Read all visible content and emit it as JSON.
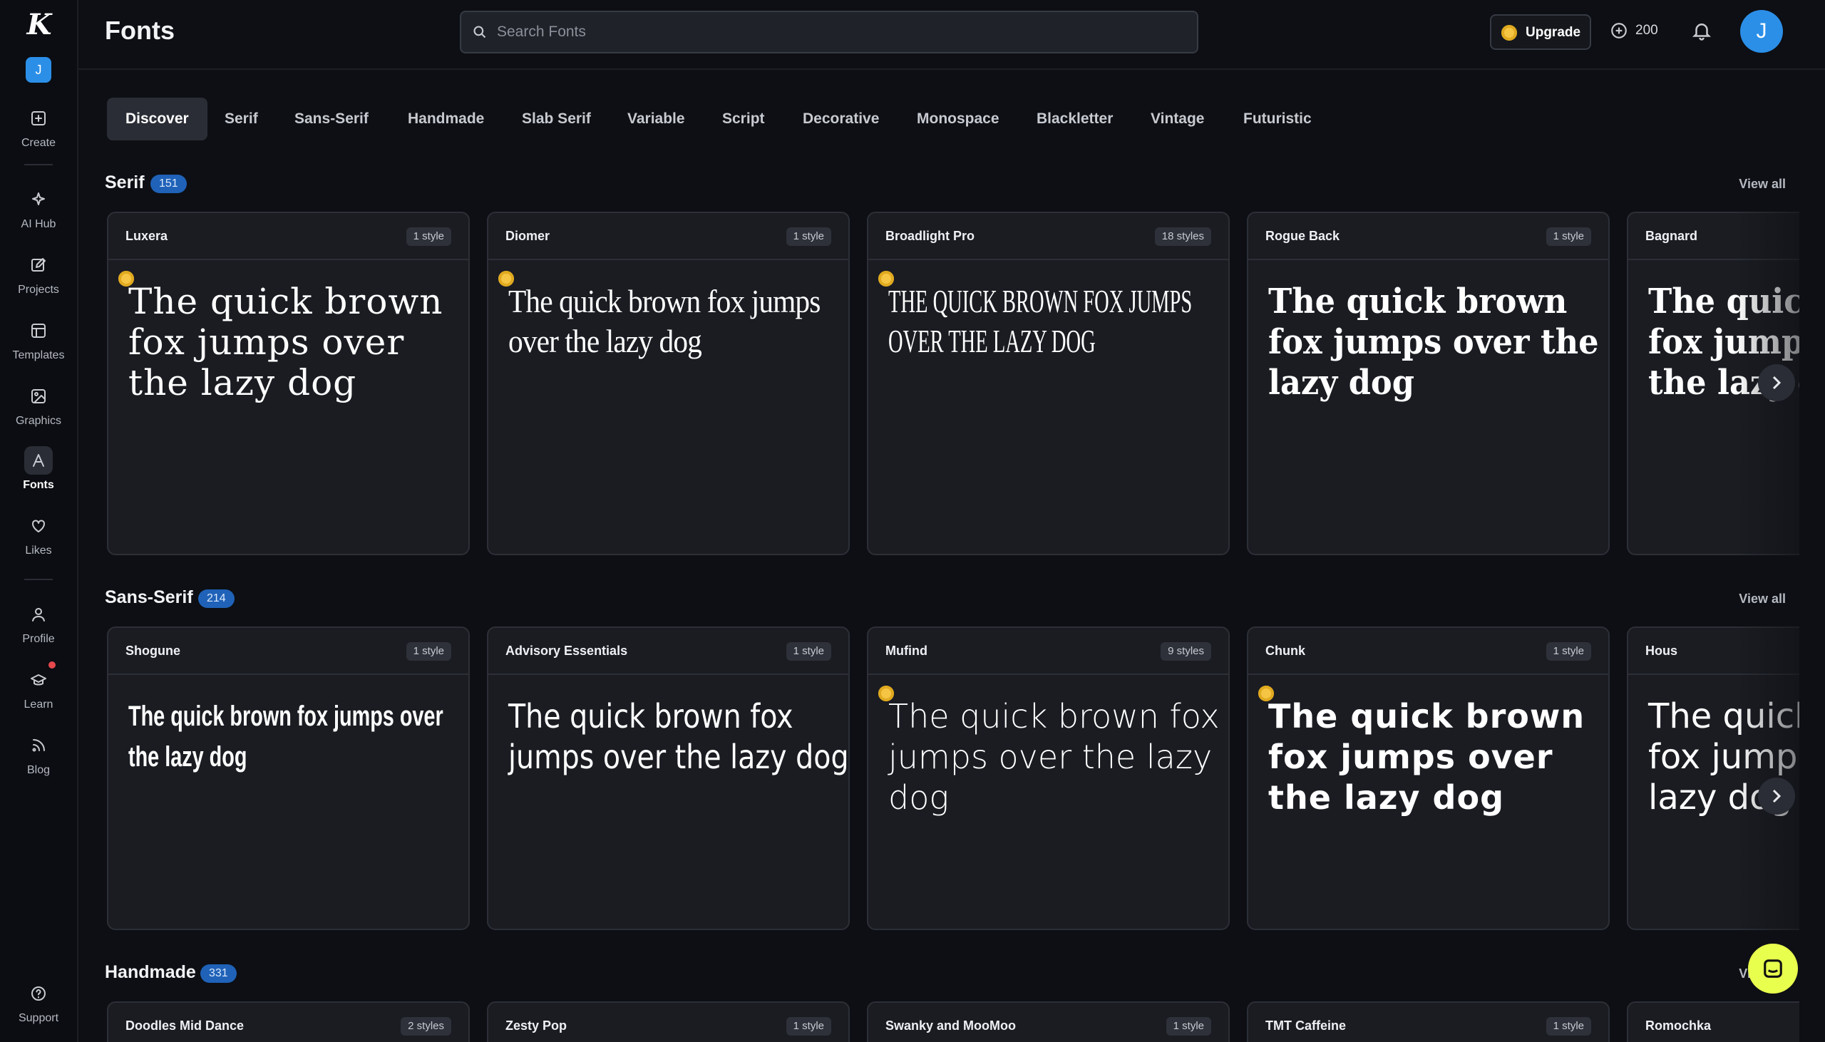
{
  "app": {
    "logo": "K",
    "workspace_initial": "J"
  },
  "sidebar": {
    "items": [
      {
        "label": "Create",
        "icon": "plus-square-icon"
      },
      {
        "label": "AI Hub",
        "icon": "sparkle-icon"
      },
      {
        "label": "Projects",
        "icon": "edit-icon"
      },
      {
        "label": "Templates",
        "icon": "template-icon"
      },
      {
        "label": "Graphics",
        "icon": "image-icon"
      },
      {
        "label": "Fonts",
        "icon": "font-icon",
        "active": true
      },
      {
        "label": "Likes",
        "icon": "heart-icon"
      },
      {
        "label": "Profile",
        "icon": "user-icon"
      },
      {
        "label": "Learn",
        "icon": "graduation-cap-icon"
      },
      {
        "label": "Blog",
        "icon": "rss-icon"
      }
    ],
    "support": "Support"
  },
  "header": {
    "title": "Fonts",
    "search_placeholder": "Search Fonts",
    "upgrade_label": "Upgrade",
    "credits": "200",
    "user_initial": "J"
  },
  "tabs": [
    "Discover",
    "Serif",
    "Sans-Serif",
    "Handmade",
    "Slab Serif",
    "Variable",
    "Script",
    "Decorative",
    "Monospace",
    "Blackletter",
    "Vintage",
    "Futuristic"
  ],
  "view_all_label": "View all",
  "sample_text": "The quick brown fox jumps over the lazy dog",
  "sections": [
    {
      "title": "Serif",
      "count": "151",
      "fonts": [
        {
          "name": "Luxera",
          "styles": "1 style",
          "premium": true
        },
        {
          "name": "Diomer",
          "styles": "1 style",
          "premium": true
        },
        {
          "name": "Broadlight Pro",
          "styles": "18 styles",
          "premium": true
        },
        {
          "name": "Rogue Back",
          "styles": "1 style",
          "premium": false
        },
        {
          "name": "Bagnard",
          "styles": "",
          "premium": false
        }
      ]
    },
    {
      "title": "Sans-Serif",
      "count": "214",
      "fonts": [
        {
          "name": "Shogune",
          "styles": "1 style",
          "premium": false
        },
        {
          "name": "Advisory Essentials",
          "styles": "1 style",
          "premium": false
        },
        {
          "name": "Mufind",
          "styles": "9 styles",
          "premium": true
        },
        {
          "name": "Chunk",
          "styles": "1 style",
          "premium": true
        },
        {
          "name": "Hous",
          "styles": "",
          "premium": false
        }
      ]
    },
    {
      "title": "Handmade",
      "count": "331",
      "fonts": [
        {
          "name": "Doodles Mid Dance",
          "styles": "2 styles"
        },
        {
          "name": "Zesty Pop",
          "styles": "1 style"
        },
        {
          "name": "Swanky and MooMoo",
          "styles": "1 style"
        },
        {
          "name": "TMT Caffeine",
          "styles": "1 style"
        },
        {
          "name": "Romochka",
          "styles": ""
        }
      ]
    }
  ],
  "colors": {
    "accent": "#2b8fe8",
    "count_badge": "#1f62b8",
    "premium_coin": "#f5c543",
    "chat_fab": "#e9ff4d"
  }
}
